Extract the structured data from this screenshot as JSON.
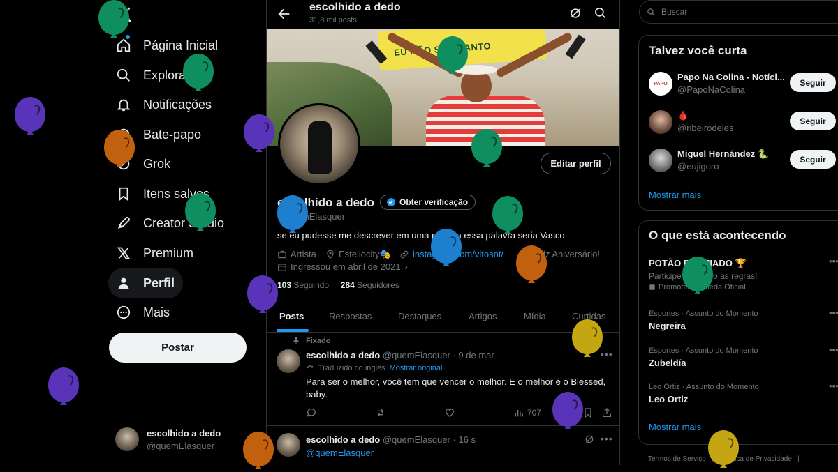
{
  "nav": {
    "logo_icon": "x-logo-icon",
    "items": [
      {
        "label": "Página Inicial",
        "icon": "home-icon"
      },
      {
        "label": "Explorar",
        "icon": "search-icon"
      },
      {
        "label": "Notificações",
        "icon": "bell-icon"
      },
      {
        "label": "Bate-papo",
        "icon": "chat-icon"
      },
      {
        "label": "Grok",
        "icon": "grok-icon"
      },
      {
        "label": "Itens salvos",
        "icon": "bookmark-icon"
      },
      {
        "label": "Creator Studio",
        "icon": "rocket-icon"
      },
      {
        "label": "Premium",
        "icon": "x-icon"
      },
      {
        "label": "Perfil",
        "icon": "person-icon"
      },
      {
        "label": "Mais",
        "icon": "more-circle-icon"
      }
    ],
    "post_label": "Postar",
    "account": {
      "name": "escolhido a dedo",
      "handle": "@quemElasquer"
    }
  },
  "header": {
    "title": "escolhido a dedo",
    "post_count": "31,8 mil posts"
  },
  "banner": {
    "text": "EU NÃO SOU SANTO"
  },
  "profile": {
    "name": "escolhido a dedo",
    "verify_label": "Obter verificação",
    "handle": "@quemElasquer",
    "bio": "se eu pudesse me descrever em uma palavra essa palavra seria Vasco",
    "category": "Artista",
    "location": "Esteliocity🎭",
    "website": "instagram.com/vitosnt/",
    "birthday": "Feliz Aniversário!",
    "joined": "Ingressou em abril de 2021",
    "following_count": "103",
    "following_label": "Seguindo",
    "followers_count": "284",
    "followers_label": "Seguidores",
    "edit_label": "Editar perfil"
  },
  "tabs": [
    "Posts",
    "Respostas",
    "Destaques",
    "Artigos",
    "Mídia",
    "Curtidas"
  ],
  "tweets": [
    {
      "pinned_label": "Fixado",
      "name": "escolhido a dedo",
      "handle": "@quemElasquer",
      "time": "· 9 de mar",
      "translated_label": "Traduzido do inglês",
      "show_original": "Mostrar original",
      "text": "Para ser o melhor, você tem que vencer o melhor. E o melhor é o Blessed, baby.",
      "views": "707"
    },
    {
      "name": "escolhido a dedo",
      "handle": "@quemElasquer",
      "time": "· 16 s",
      "text": "@quemElasquer"
    }
  ],
  "search": {
    "placeholder": "Buscar"
  },
  "who_to_follow": {
    "title": "Talvez você curta",
    "items": [
      {
        "name": "Papo Na Colina - Notíci...",
        "handle": "@PapoNaColina",
        "button": "Seguir"
      },
      {
        "name": "🩸",
        "handle": "@ribeirodeles",
        "button": "Seguir"
      },
      {
        "name": "Miguel Hernández 🐍",
        "handle": "@eujigoro",
        "button": "Seguir"
      }
    ],
    "more": "Mostrar mais"
  },
  "trends": {
    "title": "O que está acontecendo",
    "items": [
      {
        "category": "",
        "topic": "POTÃO PREMIADO 🏆",
        "sub": "Participe seguindo as regras!",
        "promoted": "Promoted by Seda Oficial"
      },
      {
        "category": "Esportes · Assunto do Momento",
        "topic": "Negreira"
      },
      {
        "category": "Esportes · Assunto do Momento",
        "topic": "Zubeldía"
      },
      {
        "category": "Leo Ortiz · Assunto do Momento",
        "topic": "Leo Ortiz"
      }
    ],
    "more": "Mostrar mais"
  },
  "footer": {
    "terms": "Termos de Serviço",
    "privacy": "Política de Privacidade"
  },
  "colors": {
    "accent": "#1d9bf0",
    "balloon_green": "#0f8f5f",
    "balloon_purple": "#5a34b8",
    "balloon_orange": "#c1610f",
    "balloon_blue": "#1e7fcf",
    "balloon_yellow": "#c4a512"
  }
}
